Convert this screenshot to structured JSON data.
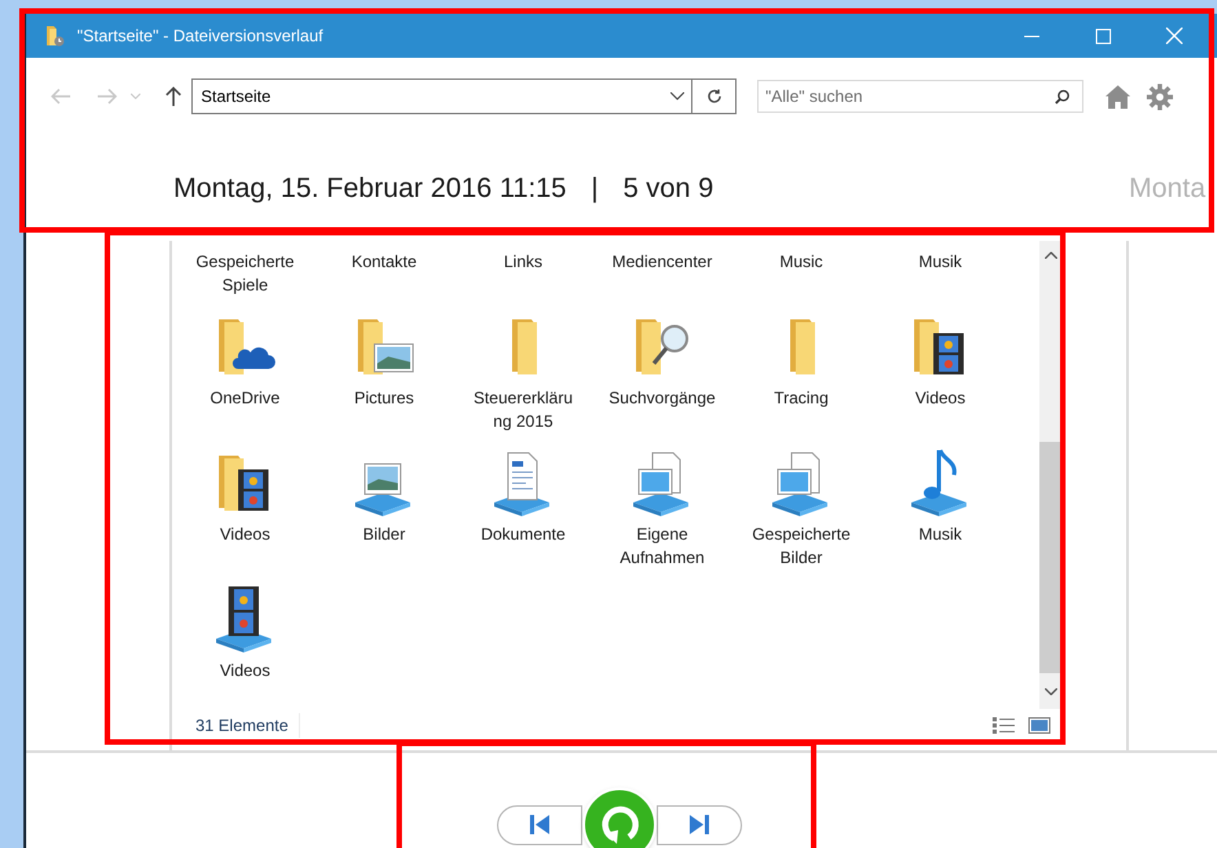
{
  "window": {
    "title": "\"Startseite\" - Dateiversionsverlauf"
  },
  "address_bar": {
    "value": "Startseite"
  },
  "search": {
    "placeholder": "\"Alle\" suchen"
  },
  "version_header": {
    "date": "Montag, 15. Februar 2016 11:15",
    "separator": "|",
    "position": "5 von 9",
    "next_version_peek": "Monta"
  },
  "files": {
    "items": [
      {
        "label": "Gespeicherte Spiele",
        "kind": "label-only",
        "selected": false
      },
      {
        "label": "Kontakte",
        "kind": "label-only",
        "selected": false
      },
      {
        "label": "Links",
        "kind": "label-only",
        "selected": false
      },
      {
        "label": "Mediencenter",
        "kind": "label-only",
        "selected": false
      },
      {
        "label": "Music",
        "kind": "label-only",
        "selected": false
      },
      {
        "label": "Musik",
        "kind": "label-only",
        "selected": false
      },
      {
        "label": "OneDrive",
        "kind": "folder-cloud",
        "selected": false
      },
      {
        "label": "Pictures",
        "kind": "folder-picture",
        "selected": false
      },
      {
        "label": "Steuererklärung 2015",
        "kind": "folder",
        "selected": false
      },
      {
        "label": "Suchvorgänge",
        "kind": "folder-search",
        "selected": false
      },
      {
        "label": "Tracing",
        "kind": "folder",
        "selected": false
      },
      {
        "label": "Videos",
        "kind": "folder-video",
        "selected": false
      },
      {
        "label": "Videos",
        "kind": "folder-video",
        "selected": false
      },
      {
        "label": "Bilder",
        "kind": "library-picture",
        "selected": false
      },
      {
        "label": "Dokumente",
        "kind": "library-document",
        "selected": false
      },
      {
        "label": "Eigene Aufnahmen",
        "kind": "library-screen",
        "selected": false
      },
      {
        "label": "Gespeicherte Bilder",
        "kind": "library-screen",
        "selected": false
      },
      {
        "label": "Musik",
        "kind": "library-music",
        "selected": false
      },
      {
        "label": "Videos",
        "kind": "library-video",
        "selected": false
      }
    ],
    "status": "31 Elemente"
  },
  "highlight_frames": [
    {
      "kind": "header"
    },
    {
      "kind": "files"
    },
    {
      "kind": "controls"
    }
  ]
}
